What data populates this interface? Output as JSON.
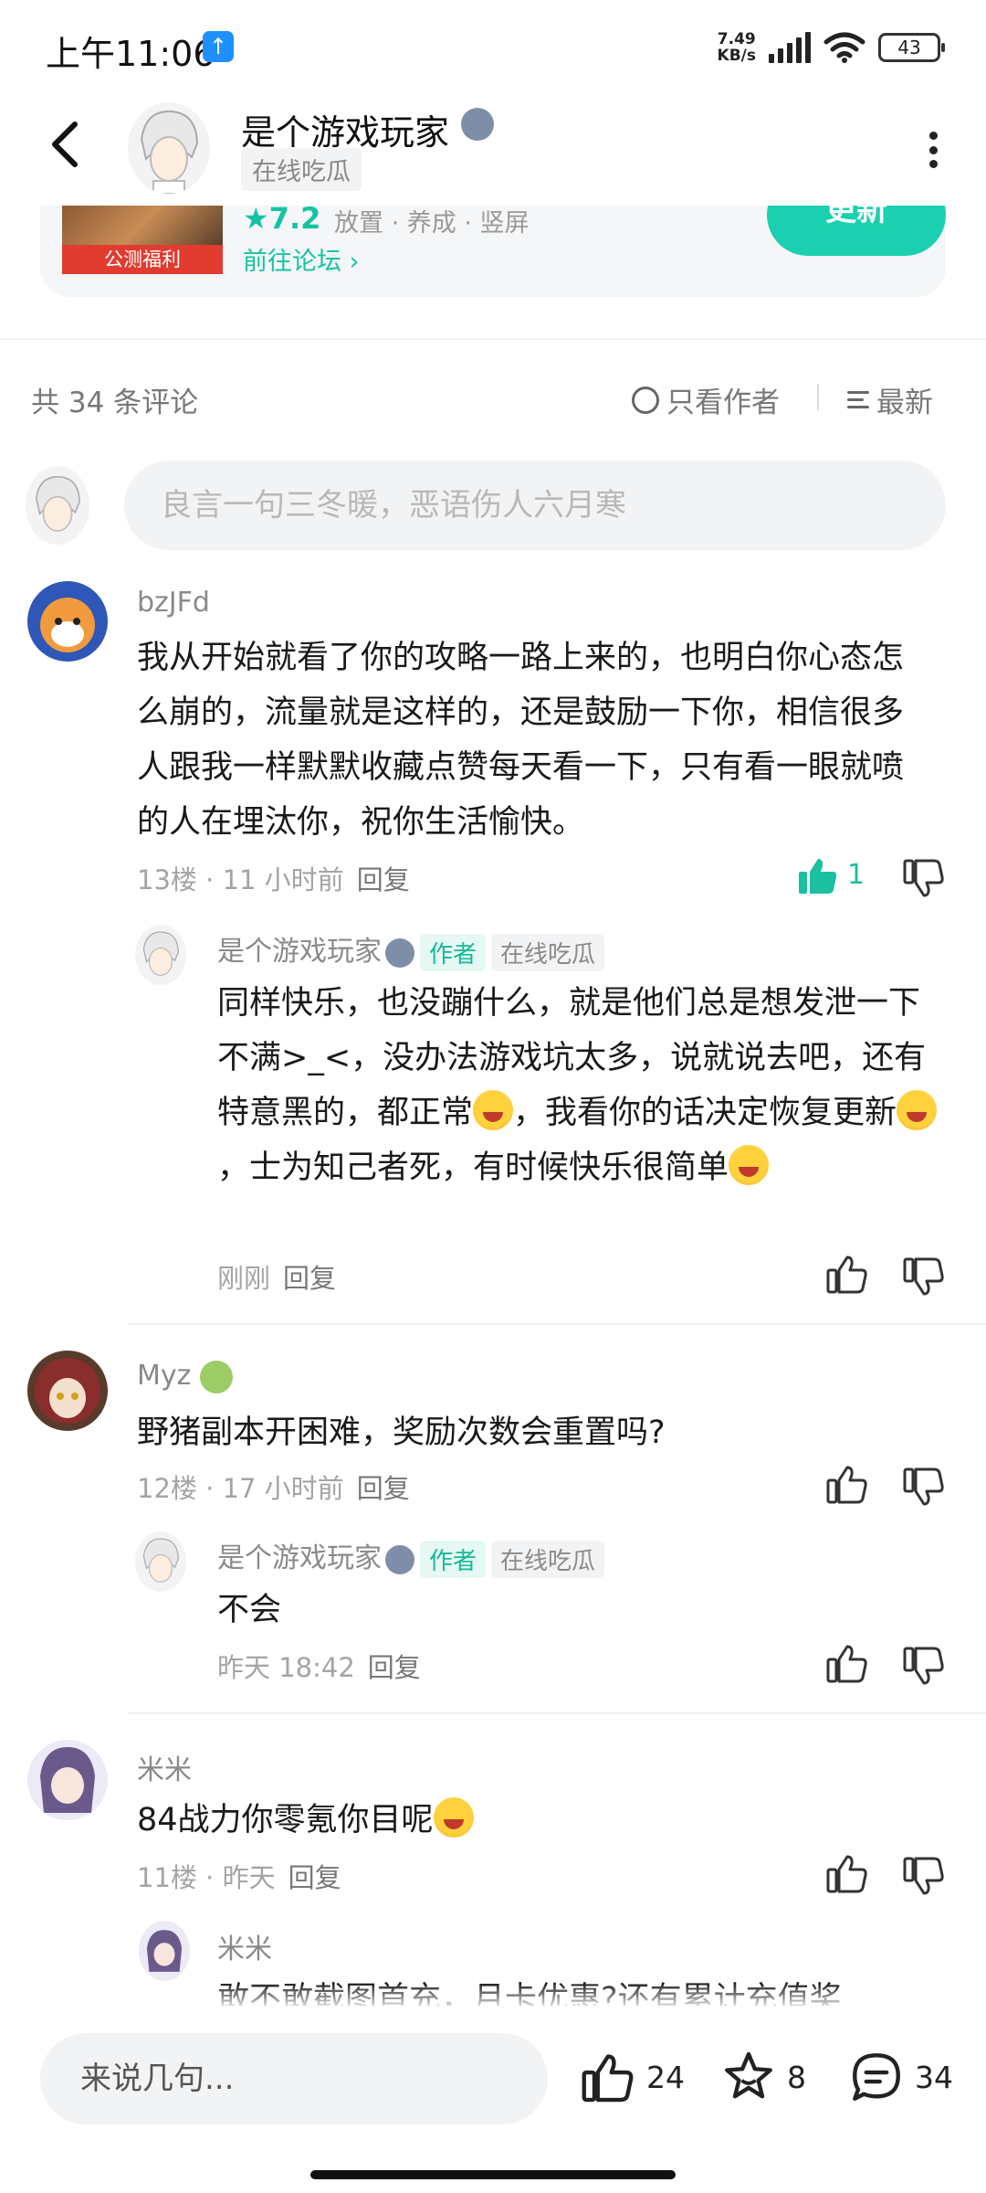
{
  "status_bar": {
    "time": "上午11:06",
    "speed_value": "7.49",
    "speed_unit": "KB/s",
    "battery": "43"
  },
  "header": {
    "author_name": "是个游戏玩家",
    "status_tag": "在线吃瓜"
  },
  "game_card": {
    "icon_label": "公测福利",
    "rating": "★7.2",
    "tags": "放置 · 养成 · 竖屏",
    "forum_link": "前往论坛 ›",
    "update_label": "更新"
  },
  "comments_header": {
    "count": "共 34 条评论",
    "only_author": "只看作者",
    "sort": "最新"
  },
  "input": {
    "placeholder": "良言一句三冬暖，恶语伤人六月寒"
  },
  "comments": [
    {
      "user": "bzJFd",
      "text": "我从开始就看了你的攻略一路上来的，也明白你心态怎么崩的，流量就是这样的，还是鼓励一下你，相信很多人跟我一样默默收藏点赞每天看一下，只有看一眼就喷的人在埋汰你，祝你生活愉快。",
      "floor": "13楼",
      "time": "11 小时前",
      "reply": "回复",
      "likes": "1",
      "sub": {
        "user": "是个游戏玩家",
        "author_tag": "作者",
        "status_tag": "在线吃瓜",
        "text_1": "同样快乐，也没蹦什么，就是他们总是想发泄一下不满>_<，没办法游戏坑太多，说就说去吧，还有特意黑的，都正常",
        "text_2": "，我看你的话决定恢复更新",
        "text_3": "，士为知己者死，有时候快乐很简单",
        "time": "刚刚",
        "reply": "回复"
      }
    },
    {
      "user": "Myz",
      "text": "野猪副本开困难，奖励次数会重置吗?",
      "floor": "12楼",
      "time": "17 小时前",
      "reply": "回复",
      "sub": {
        "user": "是个游戏玩家",
        "author_tag": "作者",
        "status_tag": "在线吃瓜",
        "text": "不会",
        "time": "昨天 18:42",
        "reply": "回复"
      }
    },
    {
      "user": "米米",
      "text": "84战力你零氪你目呢",
      "floor": "11楼",
      "time": "昨天",
      "reply": "回复",
      "sub": {
        "user": "米米",
        "text": "敢不敢截图首充，月卡优惠?还有累计充值奖"
      }
    }
  ],
  "bottom_bar": {
    "placeholder": "来说几句...",
    "likes": "24",
    "favorites": "8",
    "comments": "34"
  },
  "colors": {
    "accent": "#1bd0b0",
    "tag_bg": "#e6f8f4"
  }
}
